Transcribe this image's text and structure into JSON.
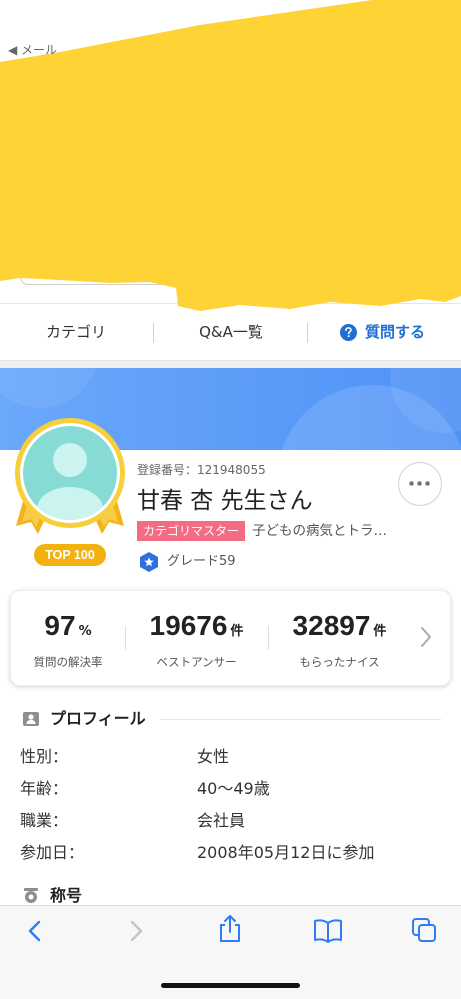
{
  "status_bar": {
    "back_label": "◀ メール"
  },
  "nav": {
    "tabs": [
      {
        "label": "カテゴリ"
      },
      {
        "label": "Q&A一覧"
      },
      {
        "label": "質問する",
        "icon": "question-circle-icon"
      }
    ]
  },
  "profile": {
    "registration_number": "登録番号：121948055",
    "name": "甘春 杏 先生さん",
    "rank_badge": "TOP 100",
    "category_badge": "カテゴリマスター",
    "category_name": "子どもの病気とトラ…",
    "grade": "グレード59",
    "avatar_icon": "default-avatar-icon",
    "more_icon": "more-options-icon"
  },
  "stats": [
    {
      "value": "97",
      "unit": "%",
      "label": "質問の解決率"
    },
    {
      "value": "19676",
      "unit": "件",
      "label": "ベストアンサー"
    },
    {
      "value": "32897",
      "unit": "件",
      "label": "もらったナイス"
    }
  ],
  "profile_section": {
    "title": "プロフィール",
    "rows": [
      {
        "label": "性別：",
        "value": "女性"
      },
      {
        "label": "年齢：",
        "value": "40〜49歳"
      },
      {
        "label": "職業：",
        "value": "会社員"
      },
      {
        "label": "参加日：",
        "value": "2008年05月12日に参加"
      }
    ]
  },
  "title_section": {
    "title": "称号"
  },
  "browser_toolbar": {
    "icons": [
      "back-icon",
      "forward-icon",
      "share-icon",
      "bookmarks-icon",
      "tabs-icon"
    ]
  },
  "colors": {
    "accent": "#1f6fd6",
    "banner_start": "#6aa8fb",
    "banner_end": "#4f92f6",
    "category_badge": "#f36b84",
    "rank_badge": "#f3b10e",
    "grade_icon": "#2f6fe0",
    "toolbar_icon": "#2f7cf6",
    "redaction": "#fed335"
  }
}
